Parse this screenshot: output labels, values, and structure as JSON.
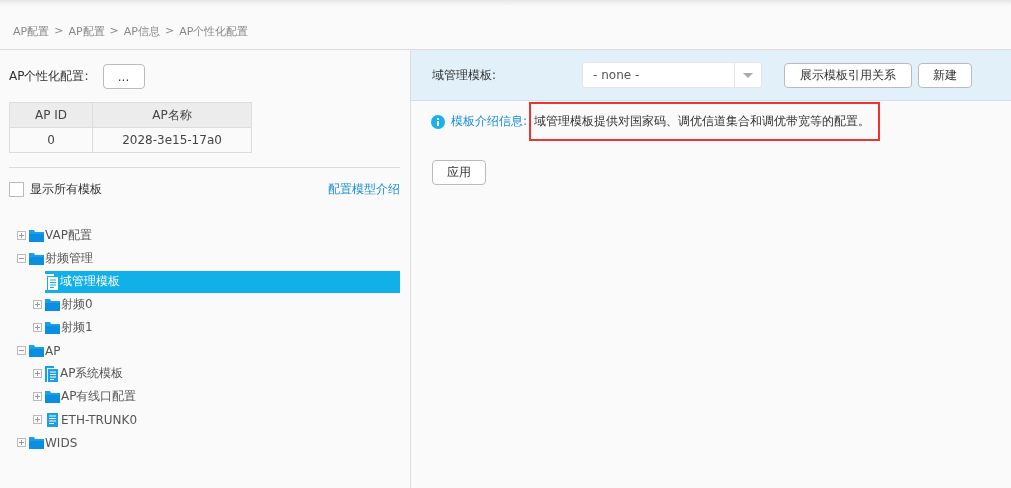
{
  "breadcrumb": [
    "AP配置",
    "AP配置",
    "AP信息",
    "AP个性化配置"
  ],
  "breadcrumb_separator": ">",
  "left": {
    "label": "AP个性化配置:",
    "picker_button": "...",
    "table": {
      "columns": [
        "AP ID",
        "AP名称"
      ],
      "rows": [
        [
          "0",
          "2028-3e15-17a0"
        ]
      ]
    },
    "show_all": {
      "label": "显示所有模板",
      "checked": false
    },
    "intro_link": "配置模型介绍",
    "tree": [
      {
        "label": "VAP配置",
        "kind": "folder",
        "expanded": false,
        "selected": false
      },
      {
        "label": "射频管理",
        "kind": "folder",
        "expanded": true,
        "selected": false,
        "children": [
          {
            "label": "域管理模板",
            "kind": "template",
            "selected": true
          },
          {
            "label": "射频0",
            "kind": "folder",
            "expanded": false,
            "selected": false
          },
          {
            "label": "射频1",
            "kind": "folder",
            "expanded": false,
            "selected": false
          }
        ]
      },
      {
        "label": "AP",
        "kind": "folder",
        "expanded": true,
        "selected": false,
        "children": [
          {
            "label": "AP系统模板",
            "kind": "template",
            "expanded": false,
            "selected": false
          },
          {
            "label": "AP有线口配置",
            "kind": "folder",
            "expanded": false,
            "selected": false
          },
          {
            "label": "ETH-TRUNK0",
            "kind": "document",
            "expanded": false,
            "selected": false
          }
        ]
      },
      {
        "label": "WIDS",
        "kind": "folder",
        "expanded": false,
        "selected": false
      }
    ]
  },
  "right": {
    "template_label": "域管理模板:",
    "template_select": {
      "value": "- none -"
    },
    "buttons": [
      "展示模板引用关系",
      "新建"
    ],
    "info": {
      "label": "模板介绍信息:",
      "text": "域管理模板提供对国家码、调优信道集合和调优带宽等的配置。",
      "highlighted": true
    },
    "apply_button": "应用"
  }
}
